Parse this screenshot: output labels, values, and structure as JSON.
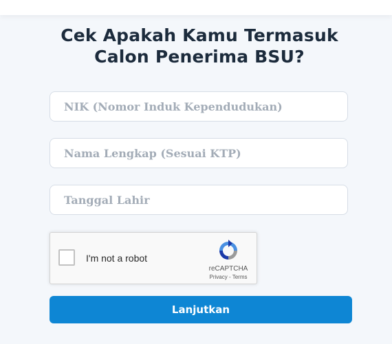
{
  "header": {
    "title_line1": "Cek Apakah Kamu Termasuk",
    "title_line2": "Calon Penerima BSU?"
  },
  "form": {
    "nik": {
      "placeholder": "NIK (Nomor Induk Kependudukan)",
      "value": ""
    },
    "nama": {
      "placeholder": "Nama Lengkap (Sesuai KTP)",
      "value": ""
    },
    "tanggal_lahir": {
      "placeholder": "Tanggal Lahir",
      "value": ""
    }
  },
  "recaptcha": {
    "checkbox_label": "I'm not a robot",
    "checked": false,
    "brand": "reCAPTCHA",
    "privacy": "Privacy",
    "separator": " - ",
    "terms": "Terms",
    "icon": "recaptcha-logo-icon"
  },
  "submit": {
    "label": "Lanjutkan"
  },
  "colors": {
    "background": "#f4f7fb",
    "title": "#1c2b3c",
    "button": "#0e86d4",
    "placeholder": "#a3acb7"
  }
}
